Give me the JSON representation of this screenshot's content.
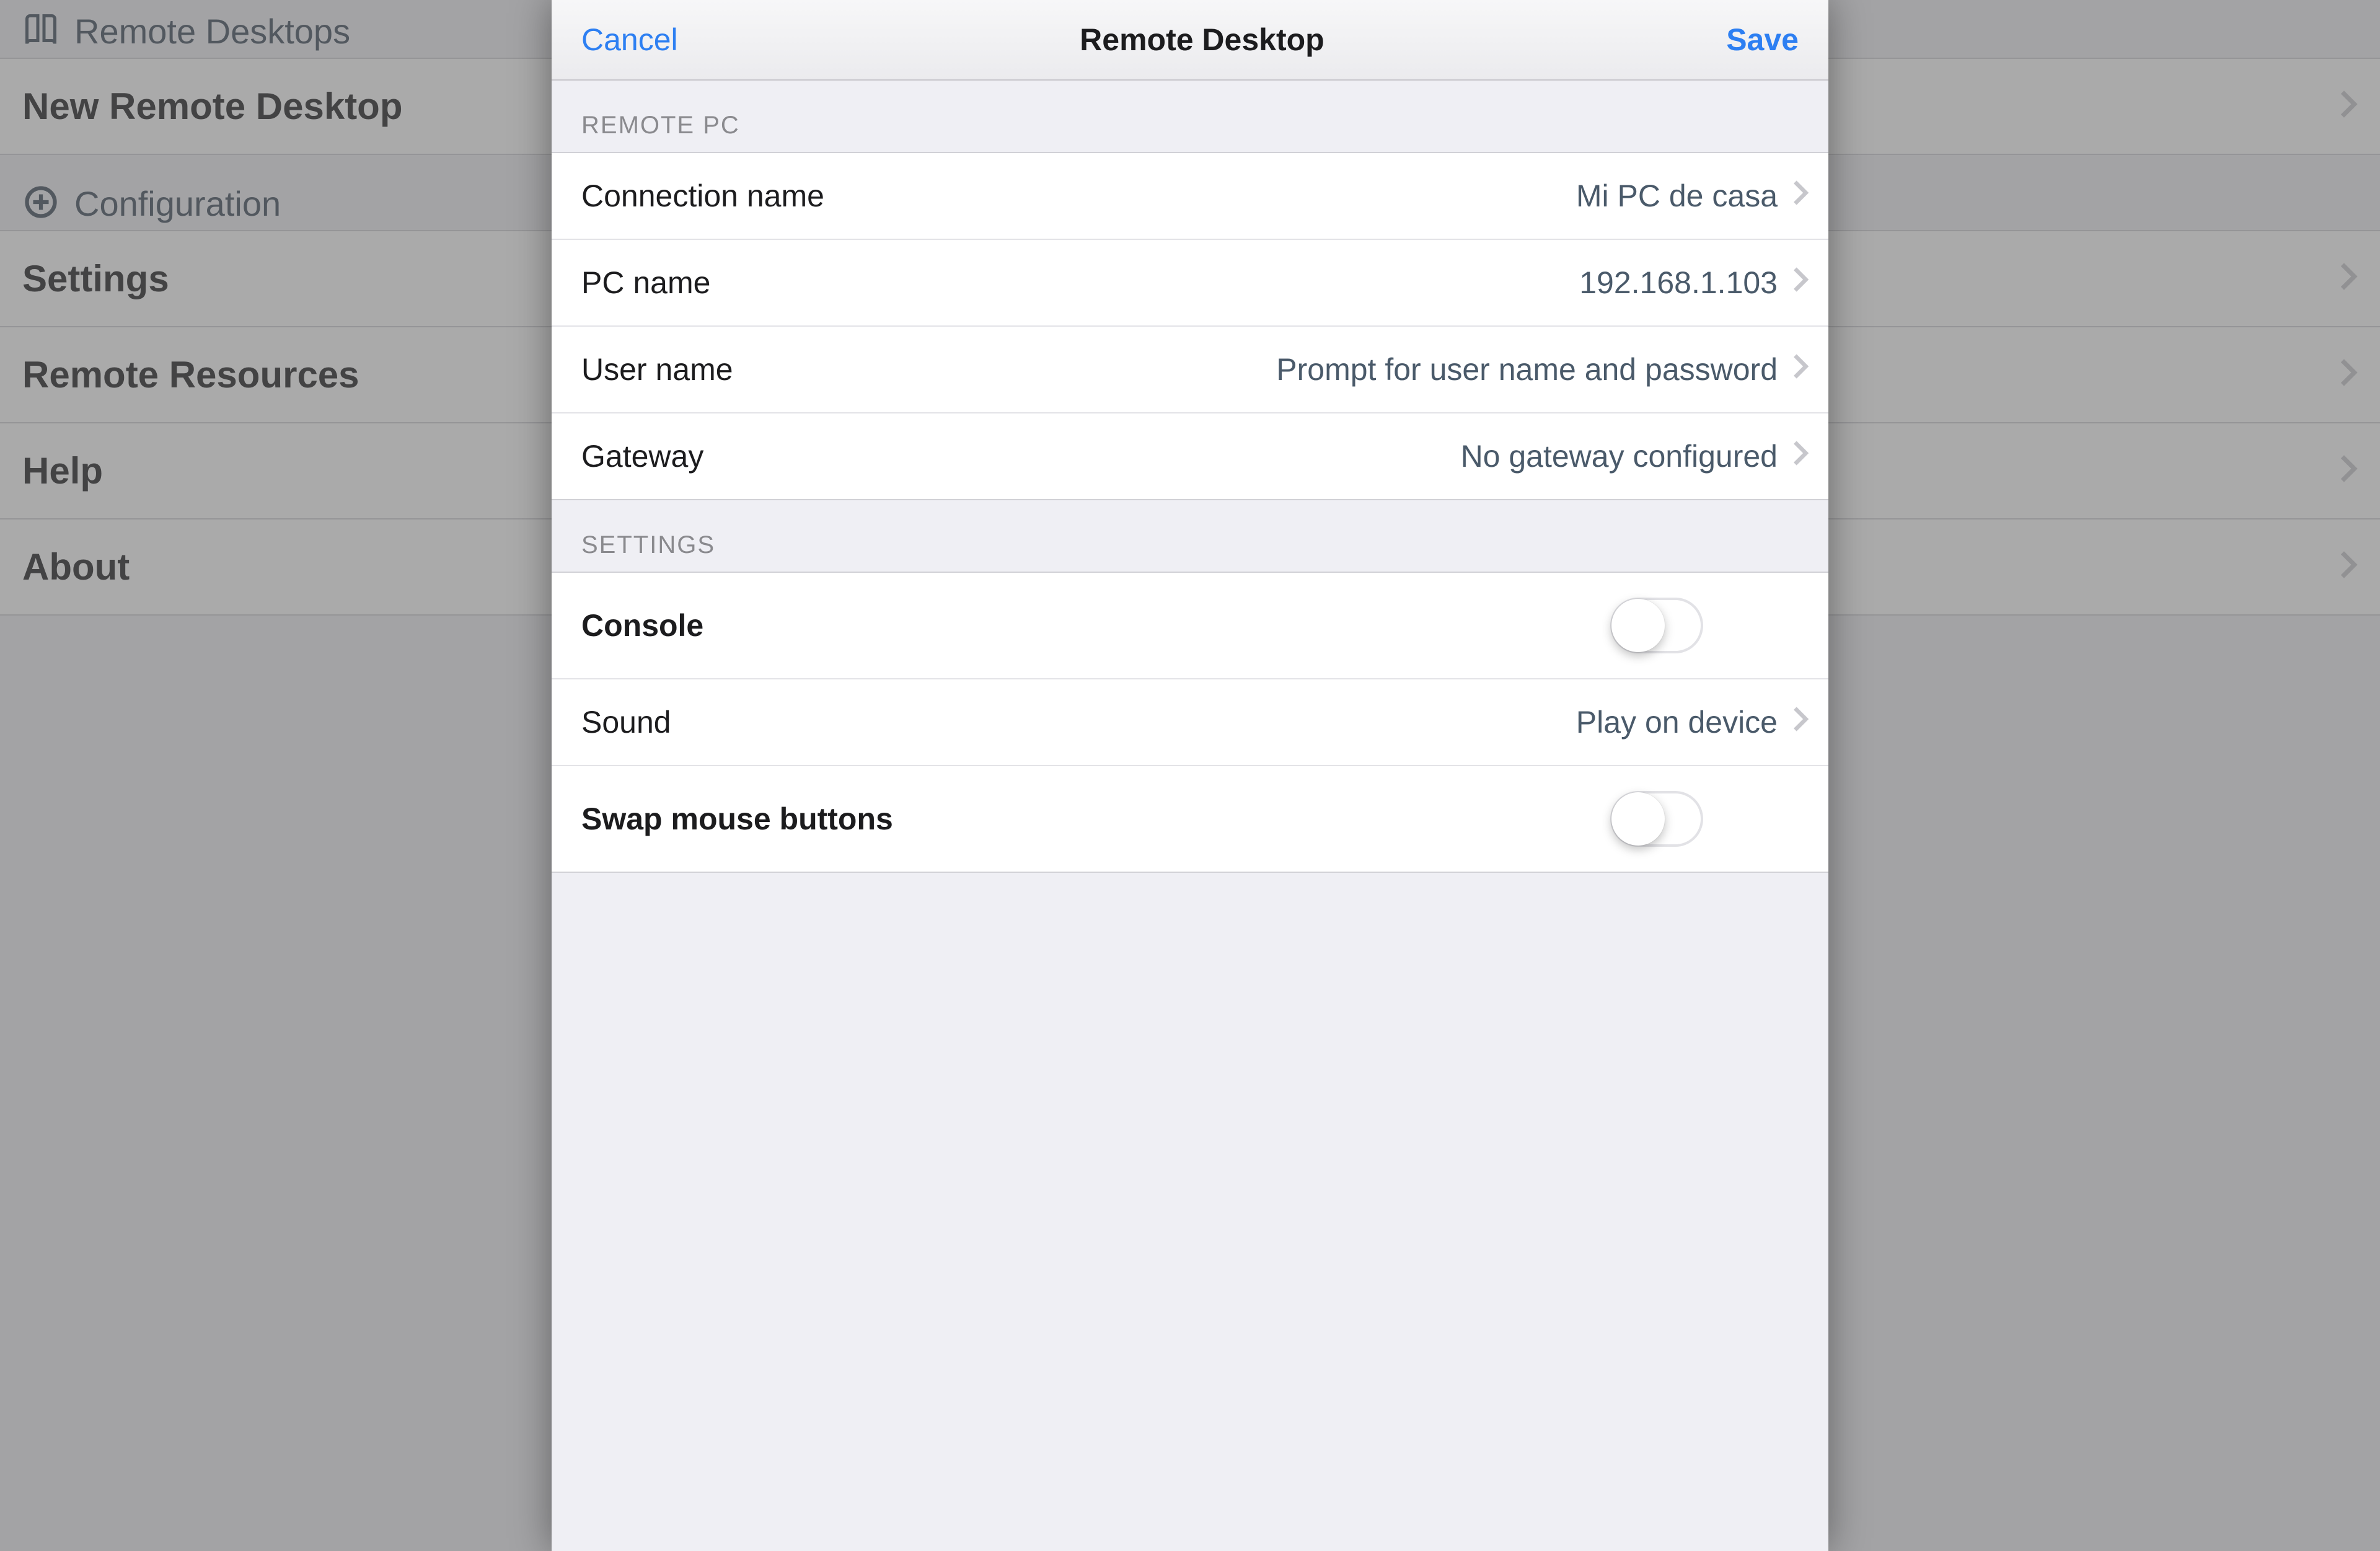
{
  "background": {
    "section_remote": {
      "header": "Remote Desktops",
      "rows": [
        {
          "label": "New Remote Desktop"
        }
      ]
    },
    "section_config": {
      "header": "Configuration",
      "rows": [
        {
          "label": "Settings"
        },
        {
          "label": "Remote Resources"
        },
        {
          "label": "Help"
        },
        {
          "label": "About"
        }
      ]
    }
  },
  "modal": {
    "cancel": "Cancel",
    "title": "Remote Desktop",
    "save": "Save",
    "groups": {
      "remote_pc": {
        "header": "REMOTE PC",
        "connection_name": {
          "label": "Connection name",
          "value": "Mi PC de casa"
        },
        "pc_name": {
          "label": "PC name",
          "value": "192.168.1.103"
        },
        "user_name": {
          "label": "User name",
          "value": "Prompt for user name and password"
        },
        "gateway": {
          "label": "Gateway",
          "value": "No gateway configured"
        }
      },
      "settings": {
        "header": "SETTINGS",
        "console": {
          "label": "Console",
          "on": false
        },
        "sound": {
          "label": "Sound",
          "value": "Play on device"
        },
        "swap_mouse": {
          "label": "Swap mouse buttons",
          "on": false
        }
      }
    }
  }
}
